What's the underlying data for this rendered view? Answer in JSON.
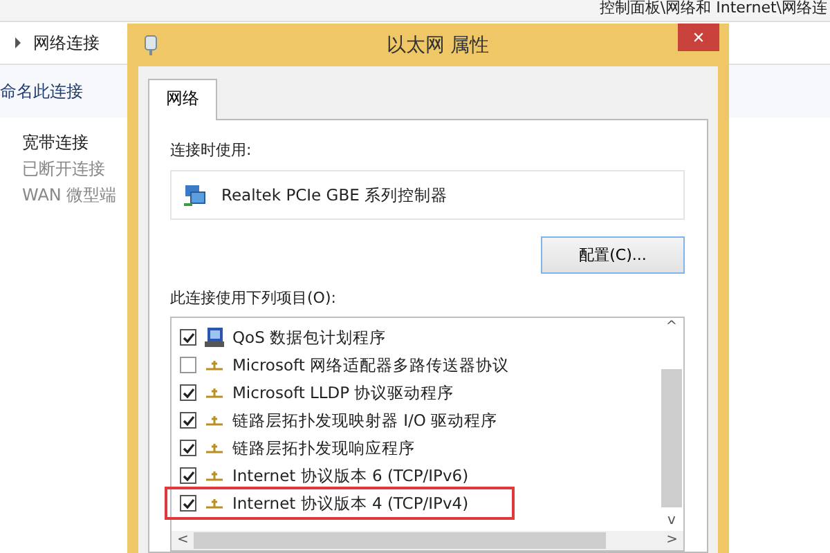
{
  "explorer": {
    "path": "控制面板\\网络和 Internet\\网络连",
    "breadcrumb": "网络连接",
    "toolbar_action": "命名此连接",
    "connection": {
      "name": "宽带连接",
      "status": "已断开连接",
      "device": "WAN 微型端"
    }
  },
  "dialog": {
    "title": "以太网 属性",
    "close": "✕",
    "tabs": [
      {
        "label": "网络",
        "selected": true
      }
    ],
    "connect_using_label": "连接时使用:",
    "adapter": "Realtek PCIe GBE 系列控制器",
    "configure_button": "配置(C)...",
    "items_label": "此连接使用下列项目(O):",
    "items": [
      {
        "kind": "scheduler",
        "label": "QoS 数据包计划程序",
        "checked": true,
        "highlighted": false
      },
      {
        "kind": "protocol",
        "label": "Microsoft 网络适配器多路传送器协议",
        "checked": false,
        "highlighted": false
      },
      {
        "kind": "protocol",
        "label": "Microsoft LLDP 协议驱动程序",
        "checked": true,
        "highlighted": false
      },
      {
        "kind": "protocol",
        "label": "链路层拓扑发现映射器 I/O 驱动程序",
        "checked": true,
        "highlighted": false
      },
      {
        "kind": "protocol",
        "label": "链路层拓扑发现响应程序",
        "checked": true,
        "highlighted": false
      },
      {
        "kind": "protocol",
        "label": "Internet 协议版本 6 (TCP/IPv6)",
        "checked": true,
        "highlighted": false
      },
      {
        "kind": "protocol",
        "label": "Internet 协议版本 4 (TCP/IPv4)",
        "checked": true,
        "highlighted": true
      }
    ],
    "scroll_up": "^",
    "scroll_down": "v",
    "scroll_left": "<",
    "scroll_right": ">"
  }
}
